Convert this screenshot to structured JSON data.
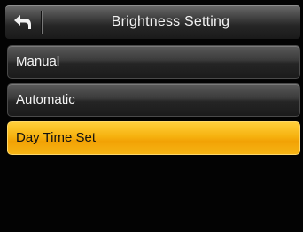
{
  "header": {
    "title": "Brightness Setting",
    "back_icon": "back-arrow-icon"
  },
  "menu": {
    "items": [
      {
        "label": "Manual",
        "selected": false
      },
      {
        "label": "Automatic",
        "selected": false
      },
      {
        "label": "Day Time Set",
        "selected": true
      }
    ]
  },
  "colors": {
    "accent": "#f4a90c",
    "background": "#030303",
    "text": "#f4f4f4"
  }
}
